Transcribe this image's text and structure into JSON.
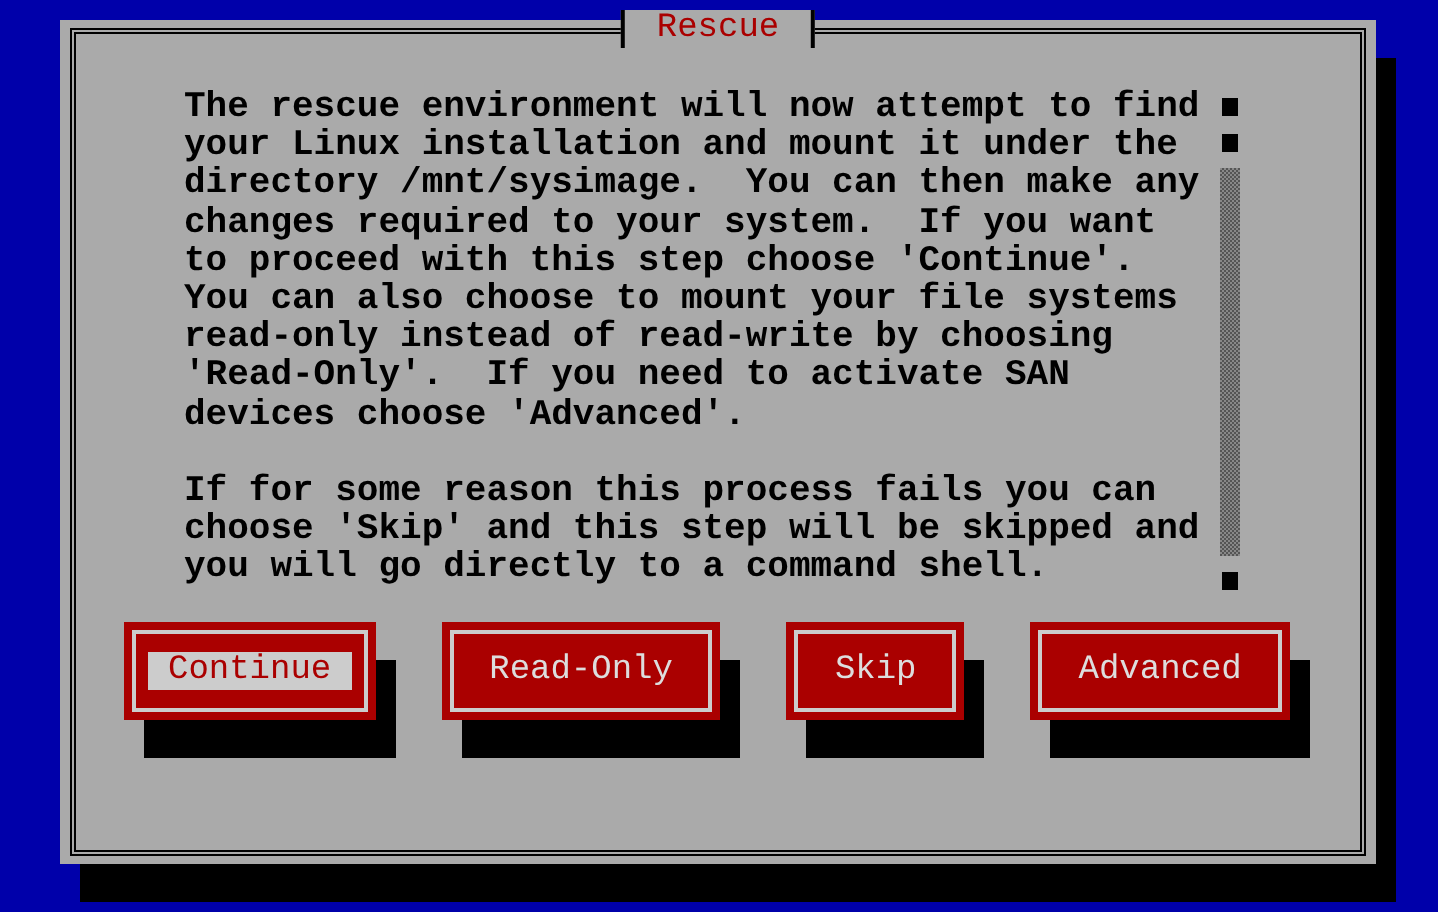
{
  "dialog": {
    "title": "Rescue",
    "paragraphs": [
      "The rescue environment will now attempt to find\nyour Linux installation and mount it under the\ndirectory /mnt/sysimage.  You can then make any\nchanges required to your system.  If you want\nto proceed with this step choose 'Continue'.\nYou can also choose to mount your file systems\nread-only instead of read-write by choosing\n'Read-Only'.  If you need to activate SAN\ndevices choose 'Advanced'.",
      "If for some reason this process fails you can\nchoose 'Skip' and this step will be skipped and\nyou will go directly to a command shell."
    ],
    "buttons": [
      {
        "label": "Continue",
        "selected": true
      },
      {
        "label": "Read-Only",
        "selected": false
      },
      {
        "label": "Skip",
        "selected": false
      },
      {
        "label": "Advanced",
        "selected": false
      }
    ]
  }
}
